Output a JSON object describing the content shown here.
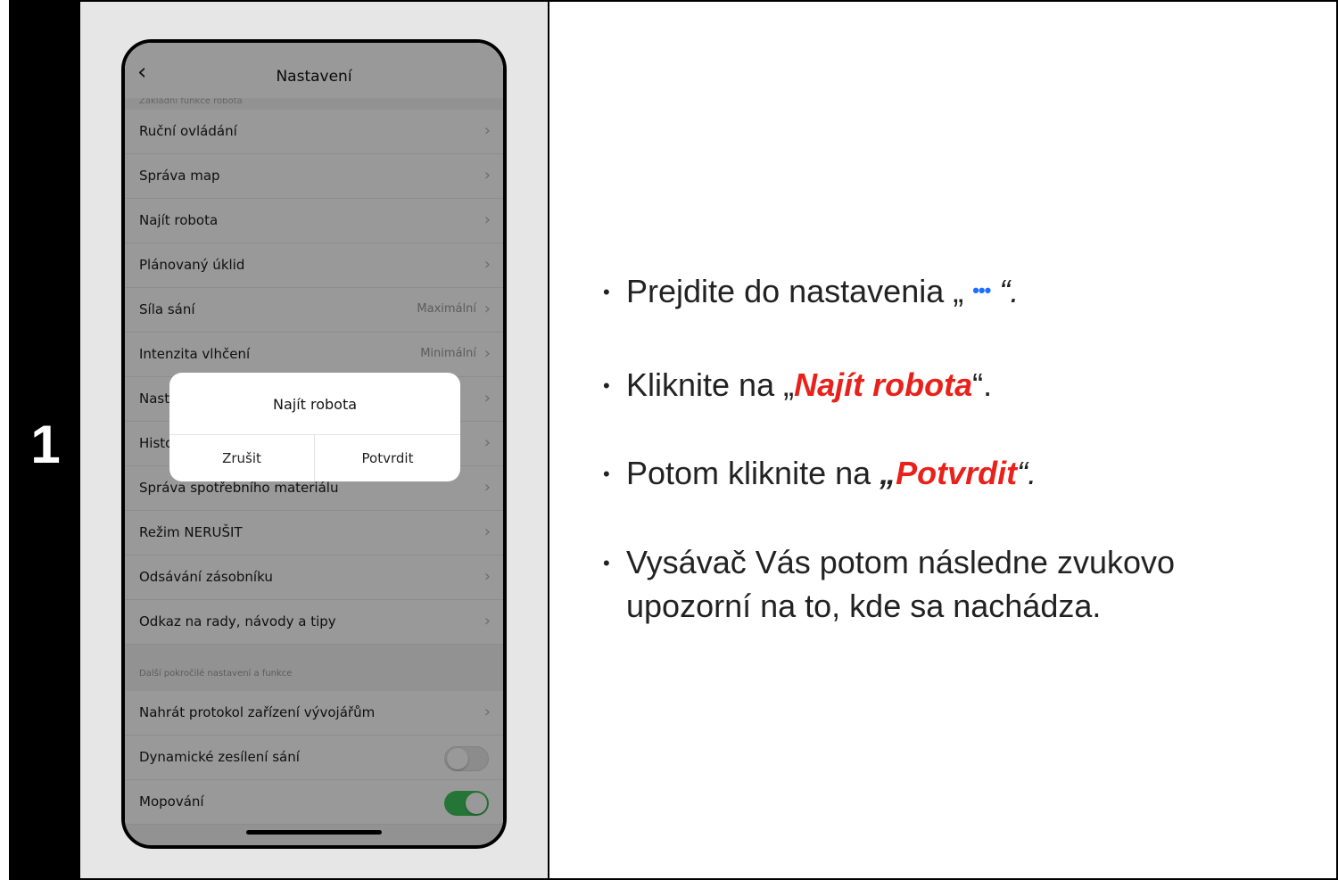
{
  "step": {
    "number": "1"
  },
  "phone": {
    "nav": {
      "back": "‹",
      "title": "Nastavení"
    },
    "section_cut": "Základní funkce robota",
    "rows": [
      {
        "label": "Ruční ovládání",
        "value": ""
      },
      {
        "label": "Správa map",
        "value": ""
      },
      {
        "label": "Najít robota",
        "value": ""
      },
      {
        "label": "Plánovaný úklid",
        "value": ""
      },
      {
        "label": "Síla sání",
        "value": "Maximální"
      },
      {
        "label": "Intenzita vlhčení",
        "value": "Minimální"
      },
      {
        "label": "Nast",
        "value": ""
      },
      {
        "label": "Histo",
        "value": ""
      },
      {
        "label": "Správa spotřebního materiálu",
        "value": ""
      },
      {
        "label": "Režim NERUŠIT",
        "value": ""
      },
      {
        "label": "Odsávání zásobníku",
        "value": ""
      },
      {
        "label": "Odkaz na rady, návody a tipy",
        "value": ""
      }
    ],
    "group2_label": "Další pokročilé nastavení a funkce",
    "rows2": [
      {
        "label": "Nahrát protokol zařízení vývojářům"
      },
      {
        "label": "Dynamické zesílení sání",
        "toggle": "off"
      },
      {
        "label": "Mopování",
        "toggle": "on"
      }
    ],
    "chevron": "›",
    "dialog": {
      "title": "Najít robota",
      "cancel": "Zrušit",
      "confirm": "Potvrdit"
    }
  },
  "instructions": {
    "b1_pre": "Prejdite do nastavenia „ ",
    "b1_icon": "•••",
    "b1_post": " “.",
    "b2_pre": "Kliknite na „",
    "b2_em": "Najít robota",
    "b2_post": "“.",
    "b3_pre": "Potom kliknite na ",
    "b3_open": "„",
    "b3_em": "Potvrdit",
    "b3_close": "“.",
    "b4_line1": "Vysávač Vás potom následne zvukovo",
    "b4_line2": "upozorní na to, kde sa nachádza."
  },
  "colors": {
    "accent_red": "#e8211b",
    "accent_blue": "#1e6fff",
    "toggle_on": "#3fc35b"
  }
}
